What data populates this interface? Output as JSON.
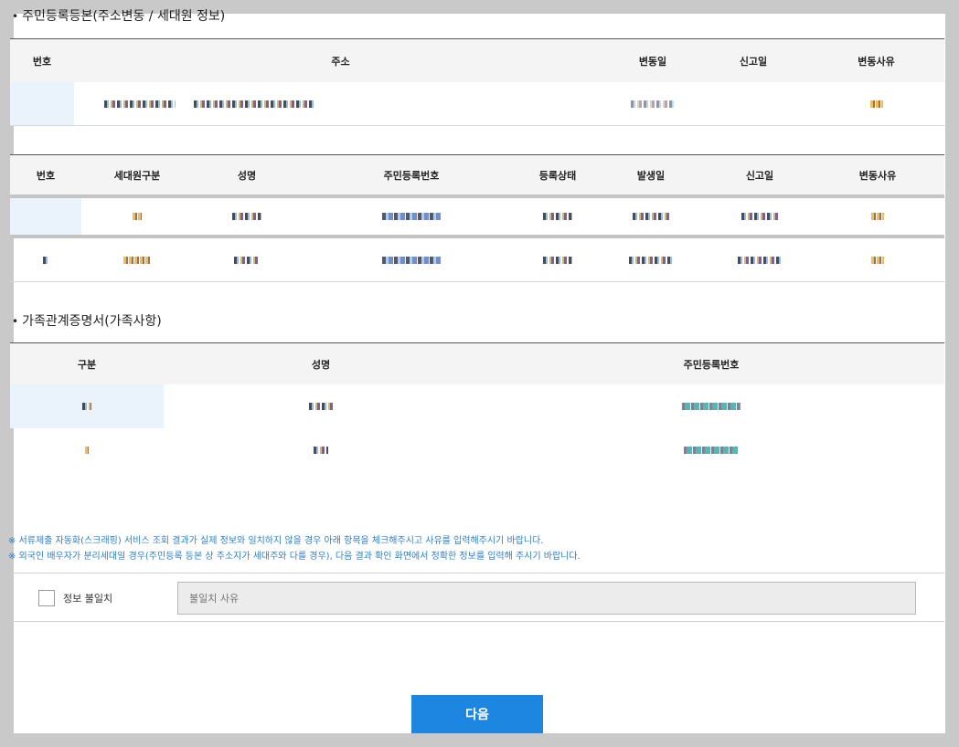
{
  "resident_register": {
    "title": "주민등록등본(주소변동 / 세대원 정보)",
    "address_table": {
      "headers": [
        "번호",
        "주소",
        "변동일",
        "신고일",
        "변동사유"
      ]
    },
    "member_table": {
      "headers": [
        "번호",
        "세대원구분",
        "성명",
        "주민등록번호",
        "등록상태",
        "발생일",
        "신고일",
        "변동사유"
      ]
    }
  },
  "family_cert": {
    "title": "가족관계증명서(가족사항)",
    "headers": [
      "구분",
      "성명",
      "주민등록번호"
    ]
  },
  "notices": [
    "※ 서류제출 자동화(스크래핑) 서비스 조회 결과가 실제 정보와 일치하지 않을 경우 아래 항목을 체크해주시고 사유를 입력해주시기 바랍니다.",
    "※ 외국인 배우자가 분리세대일 경우(주민등록 등본 상 주소지가 세대주와 다를 경우), 다음 결과 확인 화면에서 정확한 정보를 입력해 주시기 바랍니다."
  ],
  "mismatch": {
    "label": "정보 불일치",
    "placeholder": "불일치 사유"
  },
  "next_label": "다음",
  "colors": {
    "accent": "#1d86e0",
    "notice": "#2f7fc4",
    "selected_cell": "#eaf2fb"
  }
}
